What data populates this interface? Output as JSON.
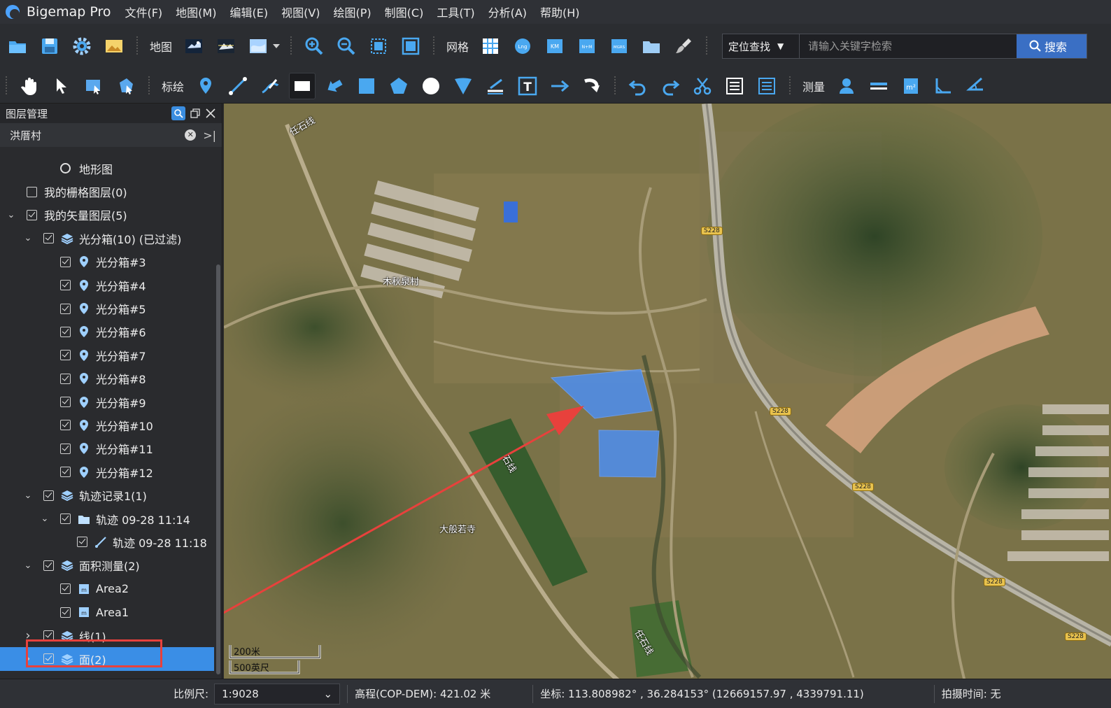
{
  "app": {
    "title": "Bigemap Pro"
  },
  "menu": [
    "文件(F)",
    "地图(M)",
    "编辑(E)",
    "视图(V)",
    "绘图(P)",
    "制图(C)",
    "工具(T)",
    "分析(A)",
    "帮助(H)"
  ],
  "toolbar1": {
    "map_label": "地图",
    "grid_label": "网格",
    "grid_buttons": [
      "Lng",
      "KM",
      "N+M",
      "MGRS"
    ],
    "search_mode": "定位查找",
    "search_placeholder": "请输入关键字检索",
    "search_button": "搜索"
  },
  "toolbar2": {
    "annotate_label": "标绘",
    "measure_label": "测量"
  },
  "layer_panel": {
    "title": "图层管理",
    "project": "洪厝村",
    "tree": [
      {
        "label": "地形图",
        "level": 2,
        "kind": "radio"
      },
      {
        "label": "我的栅格图层(0)",
        "level": 0,
        "kind": "check",
        "checked": false
      },
      {
        "label": "我的矢量图层(5)",
        "level": 0,
        "kind": "check",
        "checked": true,
        "expand": "open"
      },
      {
        "label": "光分箱(10) (已过滤)",
        "level": 1,
        "kind": "check",
        "checked": true,
        "expand": "open",
        "icon": "layers"
      },
      {
        "label": "光分箱#3",
        "level": 2,
        "kind": "check",
        "checked": true,
        "icon": "pin"
      },
      {
        "label": "光分箱#4",
        "level": 2,
        "kind": "check",
        "checked": true,
        "icon": "pin"
      },
      {
        "label": "光分箱#5",
        "level": 2,
        "kind": "check",
        "checked": true,
        "icon": "pin"
      },
      {
        "label": "光分箱#6",
        "level": 2,
        "kind": "check",
        "checked": true,
        "icon": "pin"
      },
      {
        "label": "光分箱#7",
        "level": 2,
        "kind": "check",
        "checked": true,
        "icon": "pin"
      },
      {
        "label": "光分箱#8",
        "level": 2,
        "kind": "check",
        "checked": true,
        "icon": "pin"
      },
      {
        "label": "光分箱#9",
        "level": 2,
        "kind": "check",
        "checked": true,
        "icon": "pin"
      },
      {
        "label": "光分箱#10",
        "level": 2,
        "kind": "check",
        "checked": true,
        "icon": "pin"
      },
      {
        "label": "光分箱#11",
        "level": 2,
        "kind": "check",
        "checked": true,
        "icon": "pin"
      },
      {
        "label": "光分箱#12",
        "level": 2,
        "kind": "check",
        "checked": true,
        "icon": "pin"
      },
      {
        "label": "轨迹记录1(1)",
        "level": 1,
        "kind": "check",
        "checked": true,
        "expand": "open",
        "icon": "layers"
      },
      {
        "label": "轨迹 09-28 11:14",
        "level": 2,
        "kind": "check",
        "checked": true,
        "expand": "open",
        "icon": "folder"
      },
      {
        "label": "轨迹 09-28 11:18",
        "level": 3,
        "kind": "check",
        "checked": true,
        "icon": "track"
      },
      {
        "label": "面积测量(2)",
        "level": 1,
        "kind": "check",
        "checked": true,
        "expand": "open",
        "icon": "layers"
      },
      {
        "label": "Area2",
        "level": 2,
        "kind": "check",
        "checked": true,
        "icon": "area"
      },
      {
        "label": "Area1",
        "level": 2,
        "kind": "check",
        "checked": true,
        "icon": "area"
      },
      {
        "label": "线(1)",
        "level": 1,
        "kind": "check",
        "checked": true,
        "expand": "closed",
        "icon": "layers"
      },
      {
        "label": "面(2)",
        "level": 1,
        "kind": "check",
        "checked": true,
        "expand": "closed",
        "icon": "layers",
        "selected": true
      }
    ]
  },
  "map": {
    "labels": {
      "village1": "木秋泉村",
      "temple": "大般若寺",
      "road_a": "任石线",
      "road_b": "石线",
      "road_c": "任石线"
    },
    "shields": [
      "S228",
      "S228",
      "S228",
      "S228",
      "S228"
    ],
    "scale_metric": "200米",
    "scale_imperial": "500英尺"
  },
  "status": {
    "scale_label": "比例尺:",
    "scale_value": "1:9028",
    "elevation": "高程(COP-DEM): 421.02 米",
    "coords": "坐标: 113.808982° , 36.284153°   (12669157.97 , 4339791.11)",
    "capture_time": "拍摄时间: 无"
  },
  "colors": {
    "accent": "#3a8ee6",
    "polygon": "#4d8ff0",
    "arrow": "#e8413c"
  }
}
